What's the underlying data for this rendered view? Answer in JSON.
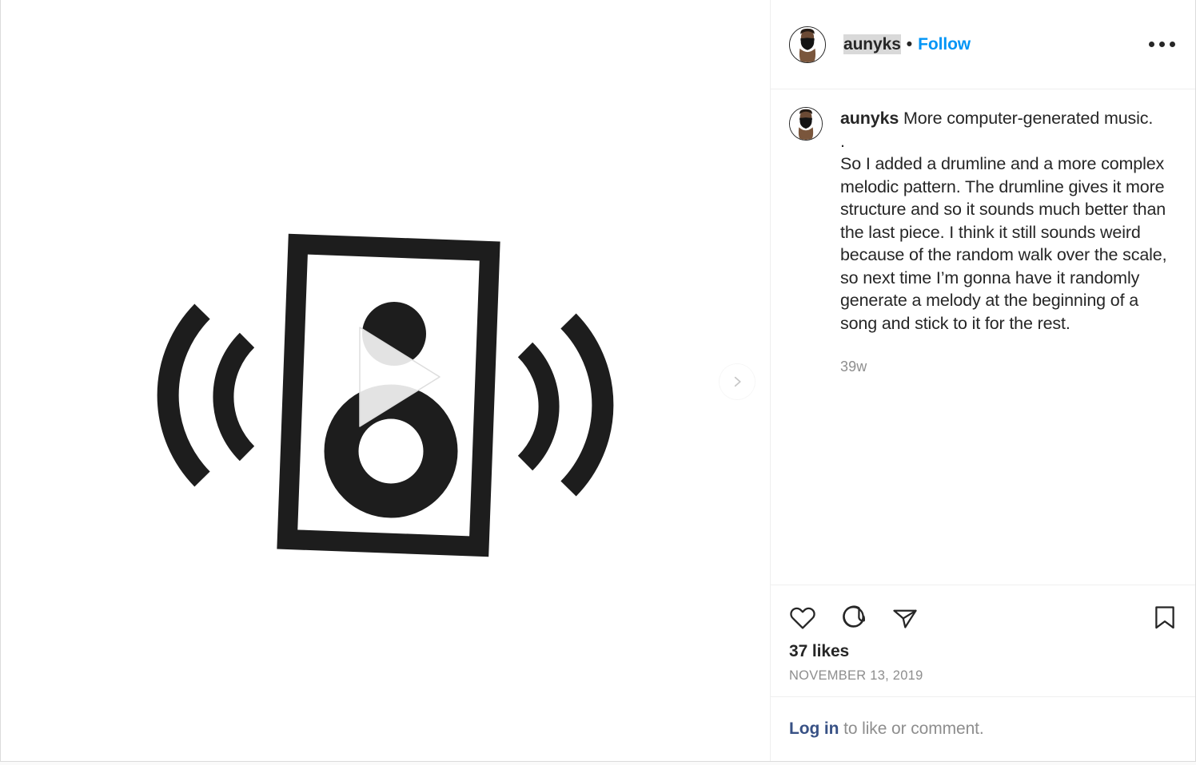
{
  "post": {
    "header": {
      "username": "aunyks",
      "separator": "•",
      "follow_label": "Follow",
      "more_options_label": "More options",
      "avatar_alt": "aunyks profile photo"
    },
    "media": {
      "type": "video",
      "alt": "Black and white illustration of a loudspeaker emitting sound waves",
      "play_overlay": true,
      "carousel_next_label": "Next"
    },
    "caption": {
      "author": "aunyks",
      "text": "More computer-generated music.\n.\nSo I added a drumline and a more complex melodic pattern. The drumline gives it more structure and so it sounds much better than the last piece. I think it still sounds weird because of the random walk over the scale, so next time I’m gonna have it randomly generate a melody at the beginning of a song and stick to it for the rest.",
      "time_ago": "39w"
    },
    "actions": {
      "like_label": "Like",
      "comment_label": "Comment",
      "share_label": "Share",
      "save_label": "Save",
      "likes": "37 likes",
      "date": "NOVEMBER 13, 2019"
    },
    "login": {
      "link_label": "Log in",
      "rest_text": " to like or comment."
    },
    "colors": {
      "link_blue": "#0095f6",
      "login_navy": "#385185",
      "text_primary": "#262626",
      "text_secondary": "#8e8e8e",
      "border": "#efefef",
      "selection_highlight": "#d9d9d9"
    }
  }
}
